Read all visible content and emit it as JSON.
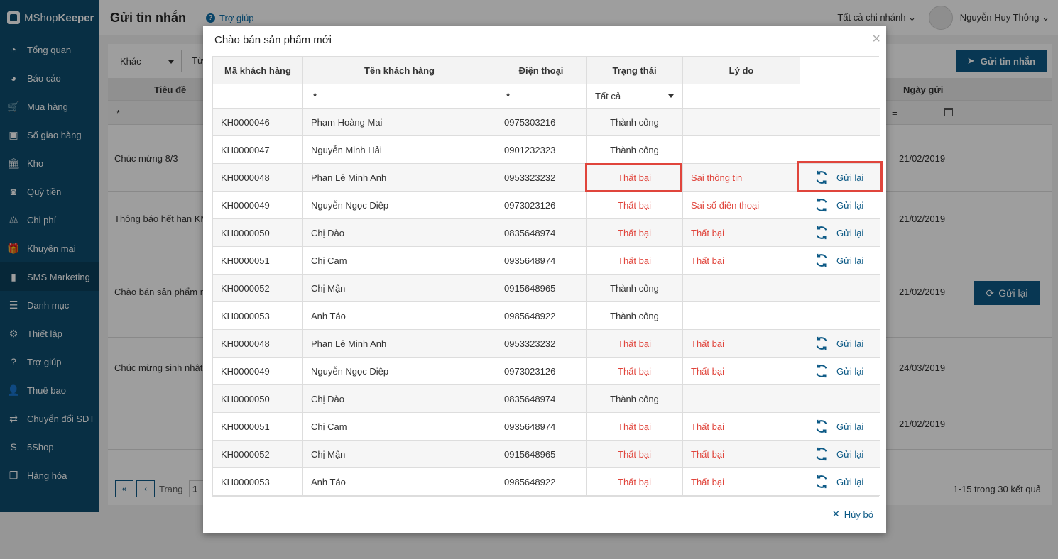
{
  "app": {
    "logo_prefix": "MShop",
    "logo_suffix": "Keeper",
    "page_title": "Gửi tin nhắn",
    "help_label": "Trợ giúp",
    "branch": "Tất cả chi nhánh",
    "user_name": "Nguyễn Huy Thông"
  },
  "sidebar": {
    "items": [
      {
        "label": "Tổng quan",
        "icon": "dashboard-icon"
      },
      {
        "label": "Báo cáo",
        "icon": "pie-chart-icon"
      },
      {
        "label": "Mua hàng",
        "icon": "cart-icon"
      },
      {
        "label": "Sổ giao hàng",
        "icon": "delivery-book-icon"
      },
      {
        "label": "Kho",
        "icon": "warehouse-icon"
      },
      {
        "label": "Quỹ tiền",
        "icon": "cash-icon"
      },
      {
        "label": "Chi phí",
        "icon": "expense-icon"
      },
      {
        "label": "Khuyến mại",
        "icon": "gift-icon"
      },
      {
        "label": "SMS Marketing",
        "icon": "phone-icon"
      },
      {
        "label": "Danh mục",
        "icon": "list-icon"
      },
      {
        "label": "Thiết lập",
        "icon": "gear-icon"
      },
      {
        "label": "Trợ giúp",
        "icon": "help-icon"
      },
      {
        "label": "Thuê bao",
        "icon": "user-icon"
      },
      {
        "label": "Chuyển đổi SĐT",
        "icon": "number-convert-icon"
      },
      {
        "label": "5Shop",
        "icon": "5shop-icon"
      },
      {
        "label": "Hàng hóa",
        "icon": "boxes-icon"
      }
    ]
  },
  "main": {
    "filter_value": "Khác",
    "filter_from": "Từ",
    "send_button": "Gửi tin nhắn",
    "col_title": "Tiêu đề",
    "col_date": "Ngày gửi",
    "filter_star": "*",
    "filter_eq": "=",
    "rows": [
      {
        "title": "Chúc mừng 8/3",
        "date": "21/02/2019"
      },
      {
        "title": "Thông báo hết hạn KM",
        "date": "21/02/2019"
      },
      {
        "title": "Chào bán sản phẩm m",
        "date": "21/02/2019"
      },
      {
        "title": "Chúc mừng sinh nhật",
        "date": "24/03/2019"
      },
      {
        "title": "",
        "date": "21/02/2019"
      }
    ],
    "resend_label": "Gửi lại",
    "pager_label": "Trang",
    "pager_value": "1",
    "pager_summary": "1-15 trong 30 kết quả"
  },
  "modal": {
    "title": "Chào bán sản phẩm mới",
    "close": "×",
    "columns": [
      "Mã khách hàng",
      "Tên khách hàng",
      "Điện thoại",
      "Trạng thái",
      "Lý do"
    ],
    "filter_op": "*",
    "status_filter": "Tất cả",
    "resend_label": "Gửi lại",
    "cancel_label": "Hủy bỏ",
    "rows": [
      {
        "code": "KH0000046",
        "name": "Phạm Hoàng Mai",
        "phone": "0975303216",
        "status": "Thành công",
        "reason": "",
        "failed": false
      },
      {
        "code": "KH0000047",
        "name": "Nguyễn Minh Hải",
        "phone": "0901232323",
        "status": "Thành công",
        "reason": "",
        "failed": false
      },
      {
        "code": "KH0000048",
        "name": "Phan Lê Minh Anh",
        "phone": "0953323232",
        "status": "Thất bại",
        "reason": "Sai thông tin",
        "failed": true
      },
      {
        "code": "KH0000049",
        "name": "Nguyễn Ngọc Diệp",
        "phone": "0973023126",
        "status": "Thất bại",
        "reason": "Sai số điện thoại",
        "failed": true
      },
      {
        "code": "KH0000050",
        "name": "Chị Đào",
        "phone": "0835648974",
        "status": "Thất bại",
        "reason": "Thất bại",
        "failed": true
      },
      {
        "code": "KH0000051",
        "name": "Chị Cam",
        "phone": "0935648974",
        "status": "Thất bại",
        "reason": "Thất bại",
        "failed": true
      },
      {
        "code": "KH0000052",
        "name": "Chị Mận",
        "phone": "0915648965",
        "status": "Thành công",
        "reason": "",
        "failed": false
      },
      {
        "code": "KH0000053",
        "name": "Anh Táo",
        "phone": "0985648922",
        "status": "Thành công",
        "reason": "",
        "failed": false
      },
      {
        "code": "KH0000048",
        "name": "Phan Lê Minh Anh",
        "phone": "0953323232",
        "status": "Thất bại",
        "reason": "Thất bại",
        "failed": true
      },
      {
        "code": "KH0000049",
        "name": "Nguyễn Ngọc Diệp",
        "phone": "0973023126",
        "status": "Thất bại",
        "reason": "Thất bại",
        "failed": true
      },
      {
        "code": "KH0000050",
        "name": "Chị Đào",
        "phone": "0835648974",
        "status": "Thành công",
        "reason": "",
        "failed": false
      },
      {
        "code": "KH0000051",
        "name": "Chị Cam",
        "phone": "0935648974",
        "status": "Thất bại",
        "reason": "Thất bại",
        "failed": true
      },
      {
        "code": "KH0000052",
        "name": "Chị Mận",
        "phone": "0915648965",
        "status": "Thất bại",
        "reason": "Thất bại",
        "failed": true
      },
      {
        "code": "KH0000053",
        "name": "Anh Táo",
        "phone": "0985648922",
        "status": "Thất bại",
        "reason": "Thất bại",
        "failed": true
      }
    ]
  },
  "colors": {
    "sidebar": "#0d4d6e",
    "primary": "#0d5a86",
    "fail": "#e0453c",
    "highlight": "#e0453c"
  }
}
